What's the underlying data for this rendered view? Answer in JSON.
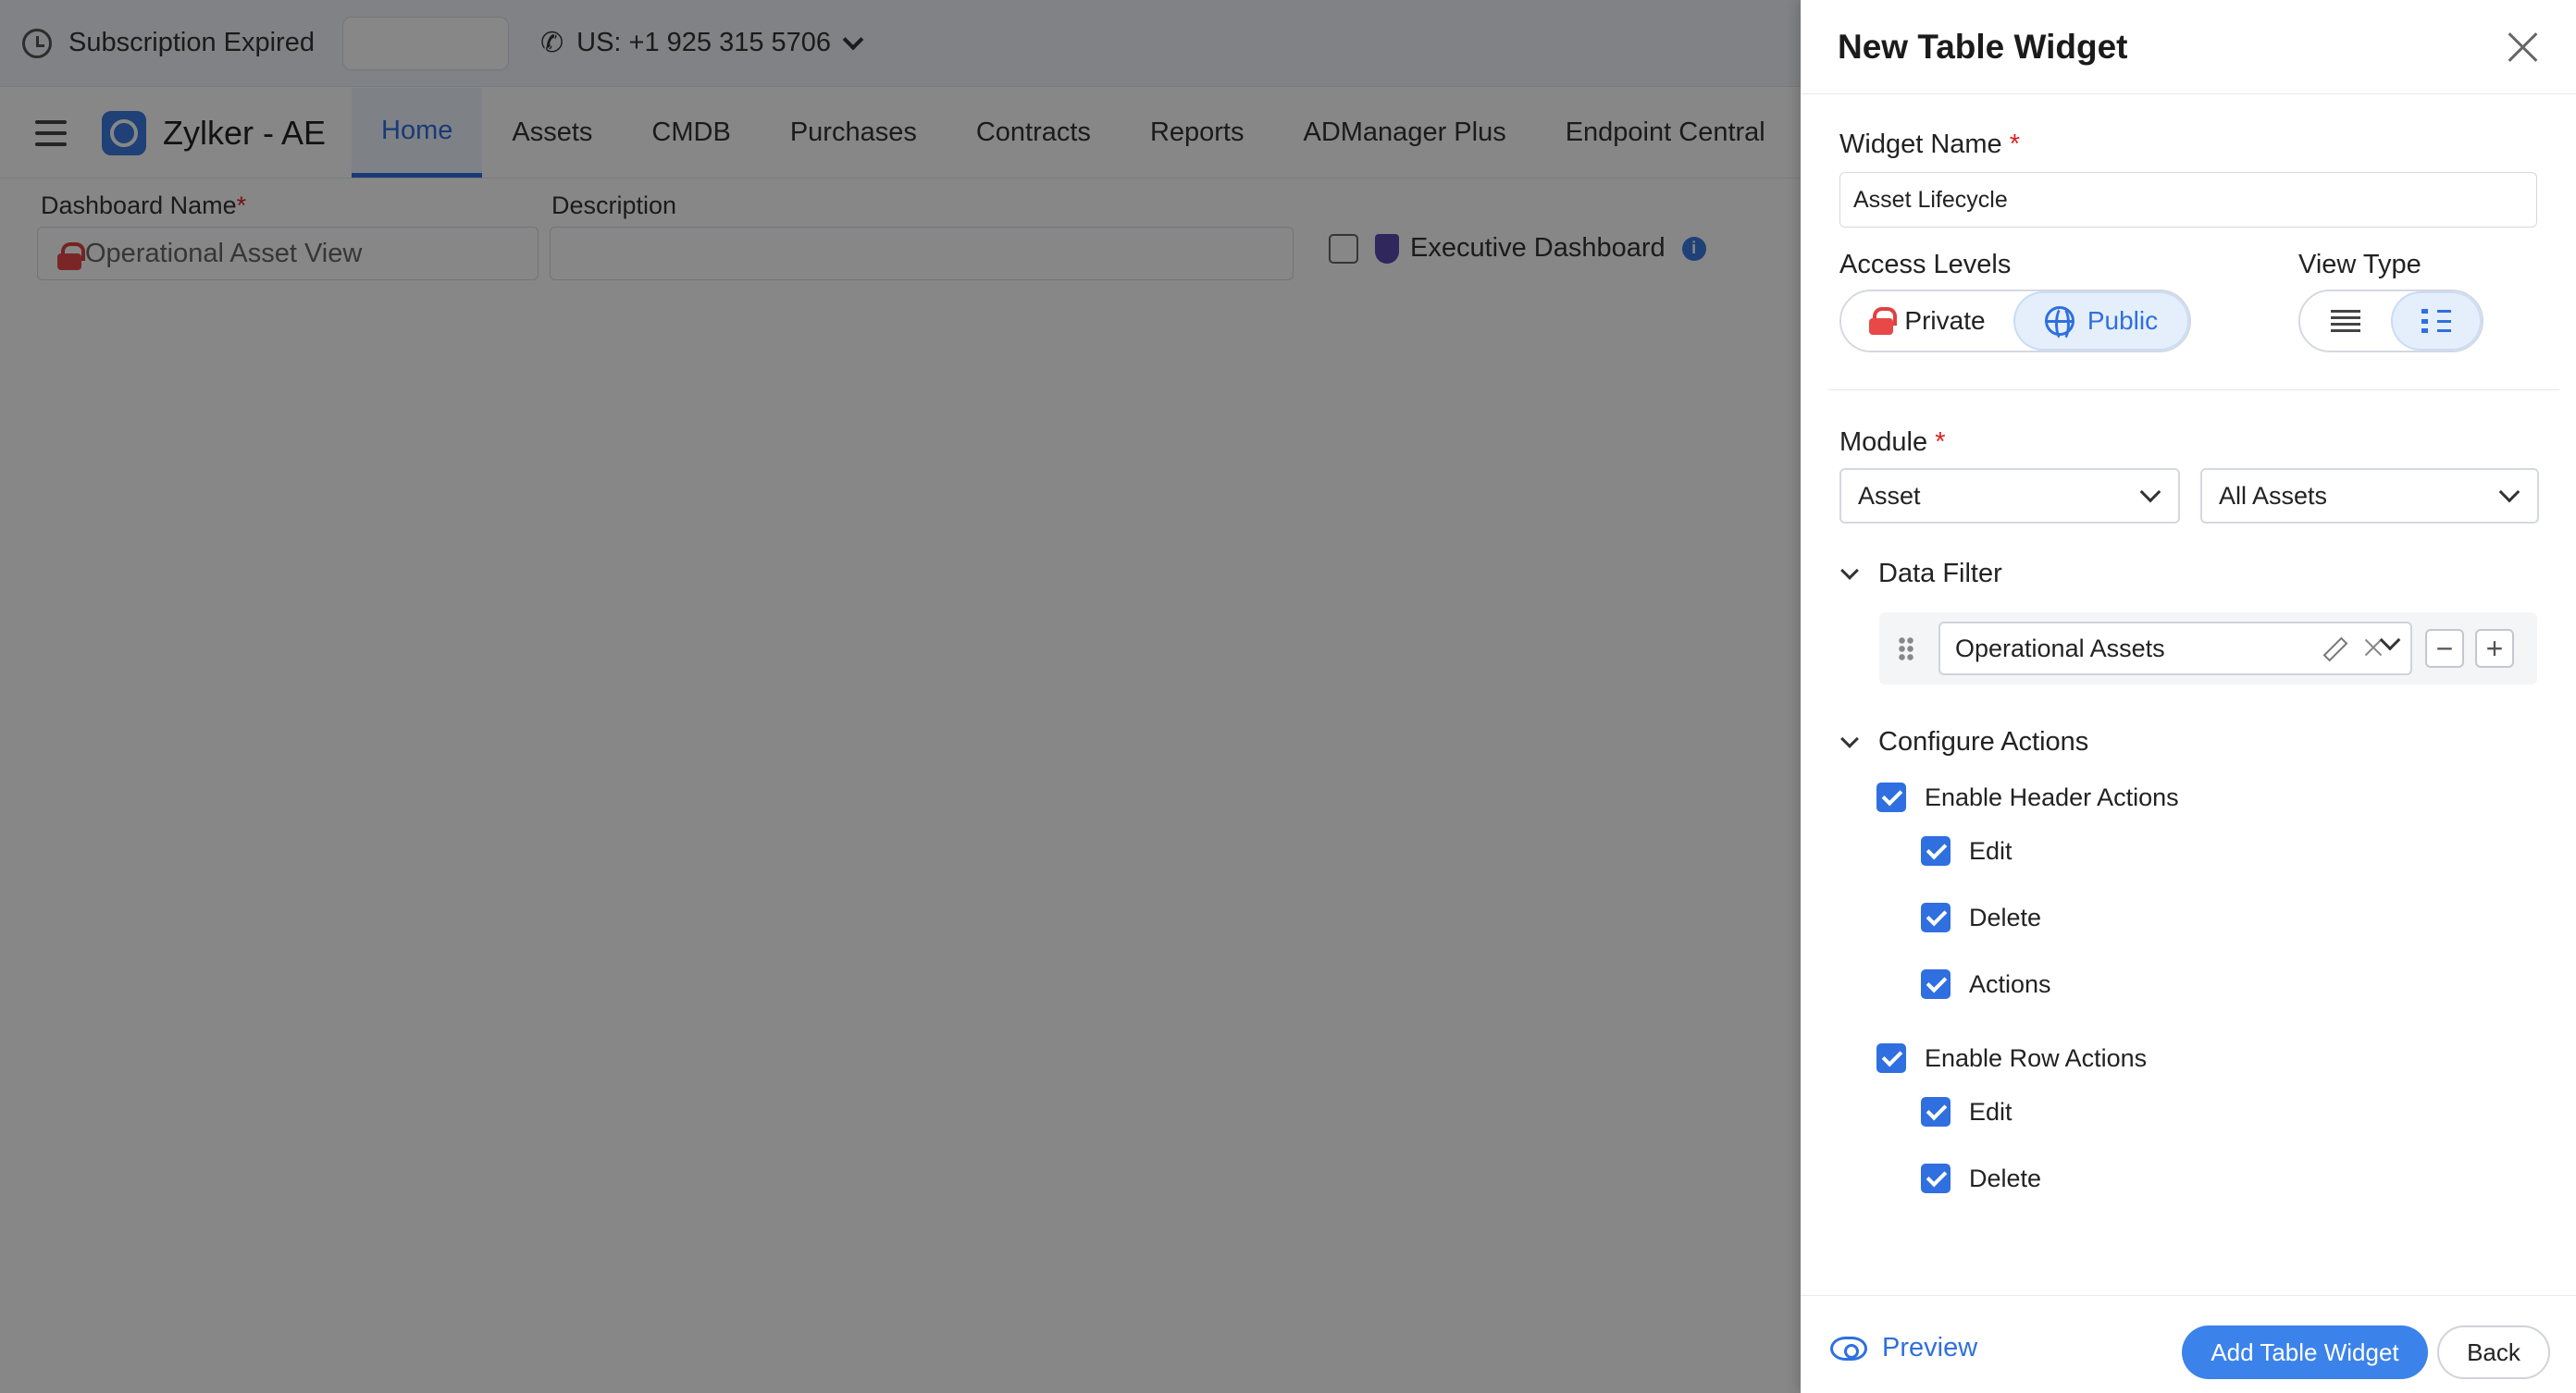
{
  "topbar": {
    "subscription_text": "Subscription Expired",
    "phone_text": "US: +1 925 315 5706"
  },
  "nav": {
    "brand": "Zylker - AE",
    "tabs": [
      "Home",
      "Assets",
      "CMDB",
      "Purchases",
      "Contracts",
      "Reports",
      "ADManager Plus",
      "Endpoint Central"
    ],
    "active_tab": "Home"
  },
  "dashboard_form": {
    "name_label": "Dashboard Name",
    "name_value": "Operational Asset View",
    "description_label": "Description",
    "description_value": "",
    "executive_label": "Executive Dashboard"
  },
  "panel": {
    "title": "New Table Widget",
    "widget_name_label": "Widget Name",
    "widget_name_value": "Asset Lifecycle",
    "access_levels_label": "Access Levels",
    "access_private": "Private",
    "access_public": "Public",
    "view_type_label": "View Type",
    "module_label": "Module",
    "module_value": "Asset",
    "module_view_value": "All Assets",
    "data_filter_label": "Data Filter",
    "filter_value": "Operational Assets",
    "configure_actions_label": "Configure Actions",
    "header_actions_label": "Enable Header Actions",
    "header_actions": [
      "Edit",
      "Delete",
      "Actions"
    ],
    "row_actions_label": "Enable Row Actions",
    "row_actions": [
      "Edit",
      "Delete"
    ],
    "preview_label": "Preview",
    "add_button": "Add Table Widget",
    "back_button": "Back",
    "required_mark": "*"
  },
  "colors": {
    "accent": "#2f6fe0",
    "primary_button": "#3b82ea",
    "required": "#e02020"
  }
}
